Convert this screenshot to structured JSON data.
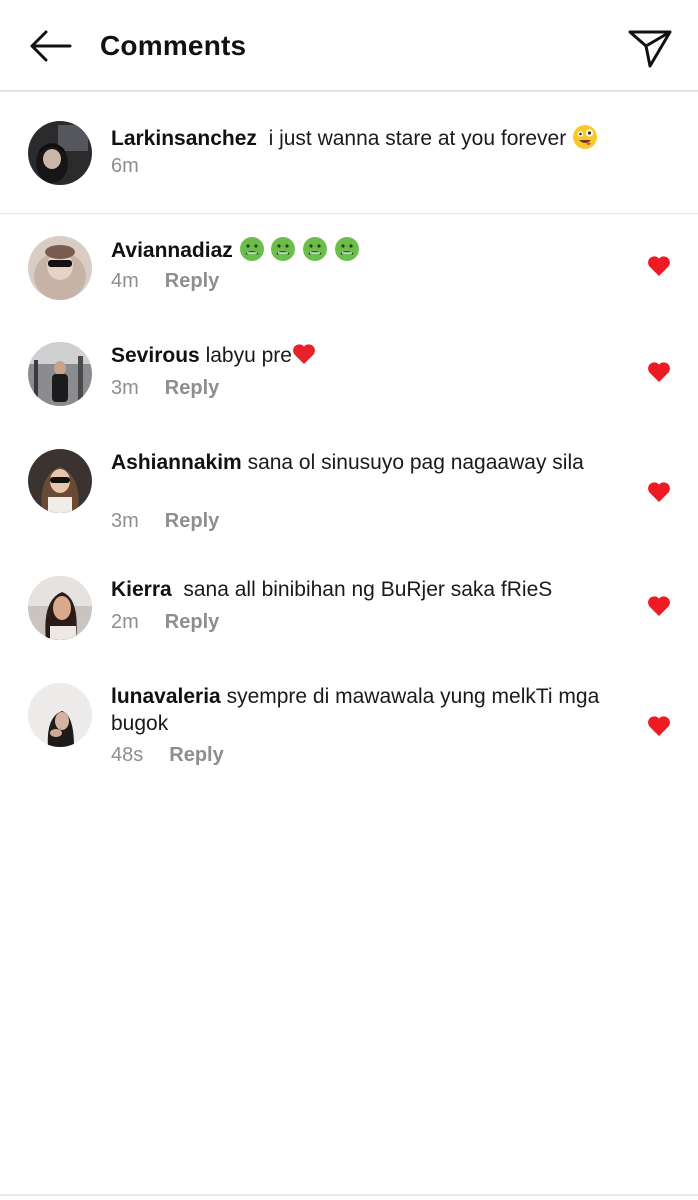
{
  "header": {
    "title": "Comments",
    "back_icon": "arrow-left-icon",
    "send_icon": "paper-plane-icon"
  },
  "caption": {
    "username": "Larkinsanchez",
    "text": "i just wanna stare at you forever",
    "emoji": "zany-face",
    "time": "6m"
  },
  "comments": [
    {
      "username": "Aviannadiaz",
      "text": "",
      "emoji": "nauseated-face x4",
      "time": "4m",
      "reply": "Reply",
      "liked": true
    },
    {
      "username": "Sevirous",
      "text": "labyu pre",
      "emoji": "red-heart",
      "time": "3m",
      "reply": "Reply",
      "liked": true
    },
    {
      "username": "Ashiannakim",
      "text": "sana ol sinusuyo pag nagaaway sila",
      "time": "3m",
      "reply": "Reply",
      "liked": true
    },
    {
      "username": "Kierra",
      "text": "sana all binibihan ng BuRjer saka fRieS",
      "time": "2m",
      "reply": "Reply",
      "liked": true
    },
    {
      "username": "lunavaleria",
      "text": "syempre di mawawala yung melkTi mga bugok",
      "time": "48s",
      "reply": "Reply",
      "liked": true
    }
  ],
  "colors": {
    "heart": "#ee1b24",
    "meta": "#8e8e8e",
    "divider": "#e2e2e2"
  }
}
